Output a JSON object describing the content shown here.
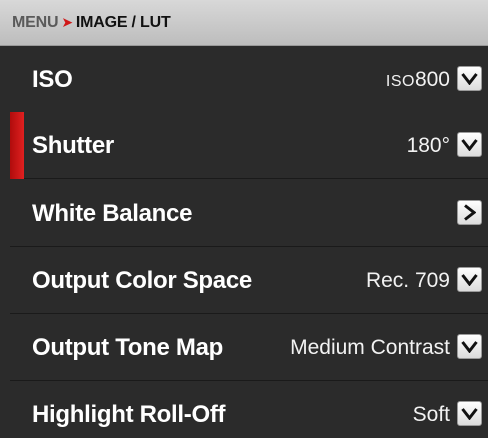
{
  "breadcrumb": {
    "menu": "MENU",
    "separator": "➤",
    "current": "IMAGE / LUT"
  },
  "rows": [
    {
      "label": "ISO",
      "value_prefix": "ISO",
      "value": "800",
      "button_icon": "chevron-down-icon",
      "selected": false
    },
    {
      "label": "Shutter",
      "value": "180°",
      "button_icon": "chevron-down-icon",
      "selected": true
    },
    {
      "label": "White Balance",
      "value": "",
      "button_icon": "chevron-right-icon",
      "selected": false
    },
    {
      "label": "Output Color Space",
      "value": "Rec. 709",
      "button_icon": "chevron-down-icon",
      "selected": false
    },
    {
      "label": "Output Tone Map",
      "value": "Medium Contrast",
      "button_icon": "chevron-down-icon",
      "selected": false
    },
    {
      "label": "Highlight Roll-Off",
      "value": "Soft",
      "button_icon": "chevron-down-icon",
      "selected": false
    }
  ],
  "colors": {
    "selection_accent": "#d01818",
    "background": "#2b2b2b",
    "header": "#c8c8c8"
  }
}
